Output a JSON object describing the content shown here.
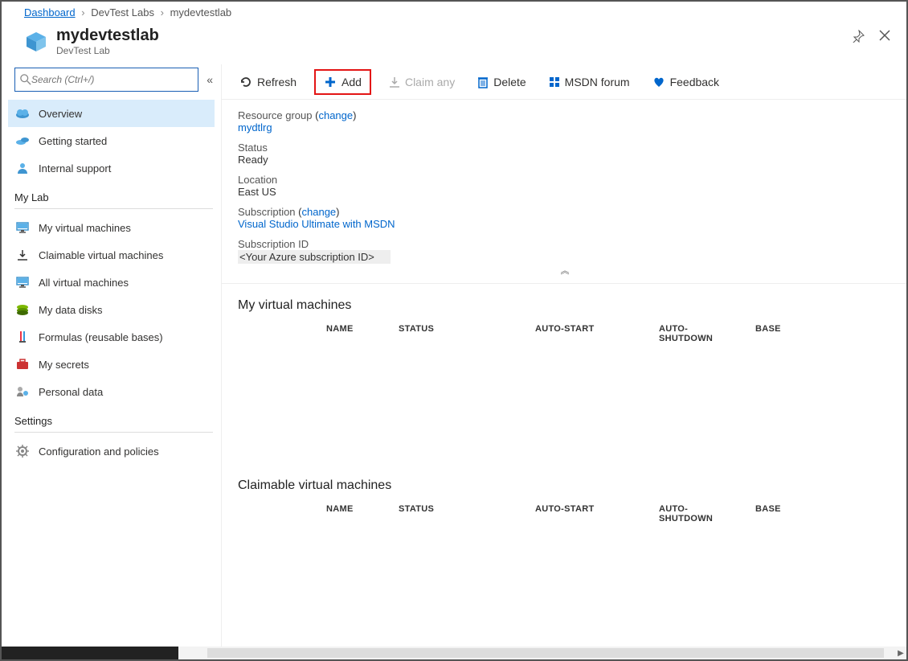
{
  "breadcrumb": {
    "dashboard": "Dashboard",
    "devtestlabs": "DevTest Labs",
    "current": "mydevtestlab"
  },
  "header": {
    "title": "mydevtestlab",
    "subtitle": "DevTest Lab"
  },
  "sidebar": {
    "search_placeholder": "Search (Ctrl+/)",
    "items": [
      {
        "label": "Overview",
        "icon": "cloud-icon"
      },
      {
        "label": "Getting started",
        "icon": "clouds-icon"
      },
      {
        "label": "Internal support",
        "icon": "person-icon"
      }
    ],
    "section_mylab": "My Lab",
    "mylab_items": [
      {
        "label": "My virtual machines",
        "icon": "monitor-icon"
      },
      {
        "label": "Claimable virtual machines",
        "icon": "download-icon"
      },
      {
        "label": "All virtual machines",
        "icon": "monitor-icon"
      },
      {
        "label": "My data disks",
        "icon": "disks-icon"
      },
      {
        "label": "Formulas (reusable bases)",
        "icon": "flask-icon"
      },
      {
        "label": "My secrets",
        "icon": "briefcase-icon"
      },
      {
        "label": "Personal data",
        "icon": "person-data-icon"
      }
    ],
    "section_settings": "Settings",
    "settings_items": [
      {
        "label": "Configuration and policies",
        "icon": "gear-icon"
      }
    ]
  },
  "toolbar": {
    "refresh": "Refresh",
    "add": "Add",
    "claim": "Claim any",
    "delete": "Delete",
    "msdn": "MSDN forum",
    "feedback": "Feedback"
  },
  "info": {
    "resource_group_label": "Resource group",
    "change_label": "change",
    "resource_group_value": "mydtlrg",
    "status_label": "Status",
    "status_value": "Ready",
    "location_label": "Location",
    "location_value": "East US",
    "subscription_label": "Subscription",
    "subscription_value": "Visual Studio Ultimate with MSDN",
    "subscription_id_label": "Subscription ID",
    "subscription_id_value": "<Your Azure subscription ID>"
  },
  "sections": {
    "my_vms": "My virtual machines",
    "claimable_vms": "Claimable virtual machines",
    "columns": {
      "name": "NAME",
      "status": "STATUS",
      "auto_start": "AUTO-START",
      "auto_shutdown": "AUTO-SHUTDOWN",
      "base": "BASE"
    }
  }
}
